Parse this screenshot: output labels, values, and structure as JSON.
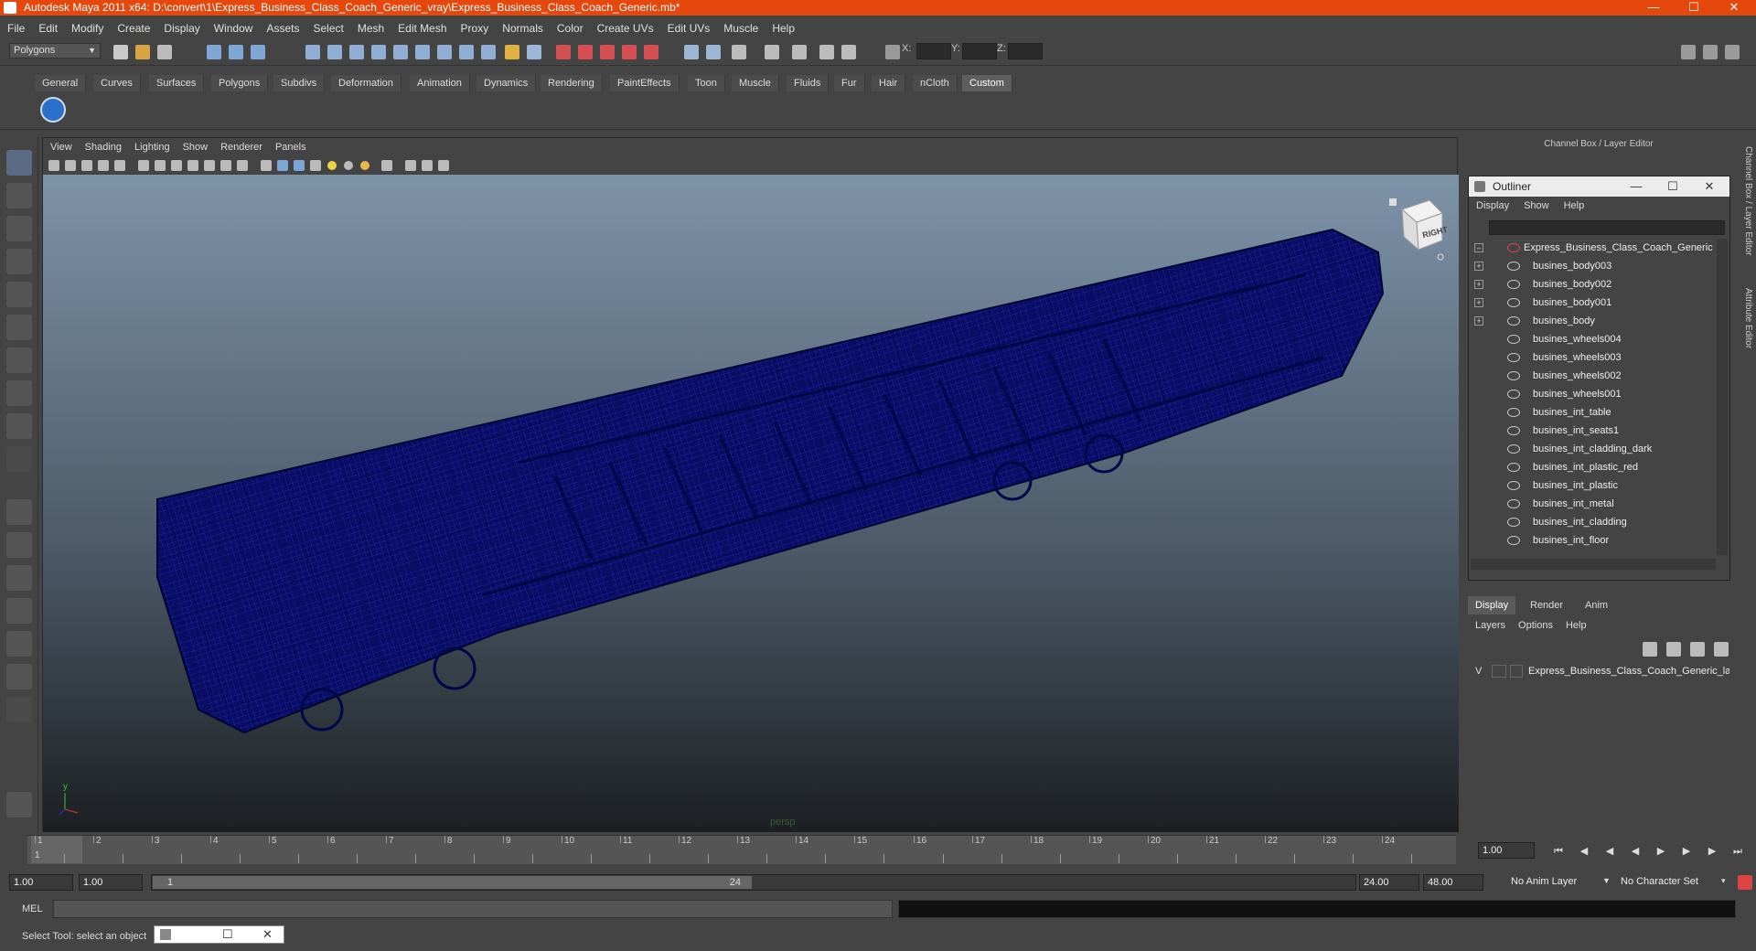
{
  "window": {
    "title": "Autodesk Maya 2011 x64: D:\\convert\\1\\Express_Business_Class_Coach_Generic_vray\\Express_Business_Class_Coach_Generic.mb*"
  },
  "menubar": [
    "File",
    "Edit",
    "Modify",
    "Create",
    "Display",
    "Window",
    "Assets",
    "Select",
    "Mesh",
    "Edit Mesh",
    "Proxy",
    "Normals",
    "Color",
    "Create UVs",
    "Edit UVs",
    "Muscle",
    "Help"
  ],
  "status_line": {
    "mode": "Polygons",
    "x_label": "X:",
    "y_label": "Y:",
    "z_label": "Z:"
  },
  "shelf_tabs": [
    "General",
    "Curves",
    "Surfaces",
    "Polygons",
    "Subdivs",
    "Deformation",
    "Animation",
    "Dynamics",
    "Rendering",
    "PaintEffects",
    "Toon",
    "Muscle",
    "Fluids",
    "Fur",
    "Hair",
    "nCloth",
    "Custom"
  ],
  "active_shelf": "Custom",
  "panel_menu": [
    "View",
    "Shading",
    "Lighting",
    "Show",
    "Renderer",
    "Panels"
  ],
  "viewport": {
    "camera": "persp",
    "viewcube_face": "RIGHT",
    "axis_y": "y"
  },
  "channel_box": {
    "title": "Channel Box / Layer Editor"
  },
  "outliner": {
    "title": "Outliner",
    "menu": [
      "Display",
      "Show",
      "Help"
    ],
    "root": "Express_Business_Class_Coach_Generic",
    "items": [
      "busines_body003",
      "busines_body002",
      "busines_body001",
      "busines_body",
      "busines_wheels004",
      "busines_wheels003",
      "busines_wheels002",
      "busines_wheels001",
      "busines_int_table",
      "busines_int_seats1",
      "busines_int_cladding_dark",
      "busines_int_plastic_red",
      "busines_int_plastic",
      "busines_int_metal",
      "busines_int_cladding",
      "busines_int_floor"
    ]
  },
  "layer_editor": {
    "tabs": [
      "Display",
      "Render",
      "Anim"
    ],
    "menu": [
      "Layers",
      "Options",
      "Help"
    ],
    "layer_visibility": "V",
    "layer_name": "Express_Business_Class_Coach_Generic_la"
  },
  "side_tabs": [
    "Channel Box / Layer Editor",
    "Attribute Editor"
  ],
  "timeline": {
    "ticks": [
      "1",
      "2",
      "3",
      "4",
      "5",
      "6",
      "7",
      "8",
      "9",
      "10",
      "11",
      "12",
      "13",
      "14",
      "15",
      "16",
      "17",
      "18",
      "19",
      "20",
      "21",
      "22",
      "23",
      "24"
    ],
    "current_frame_marker": "1",
    "current_time": "1.00"
  },
  "range": {
    "start": "1.00",
    "playback_start": "1.00",
    "slider_start": "1",
    "slider_end": "24",
    "playback_end": "24.00",
    "end": "48.00",
    "anim_layer": "No Anim Layer",
    "character_set": "No Character Set"
  },
  "command_line": {
    "label": "MEL"
  },
  "help_line": {
    "text": "Select Tool: select an object"
  }
}
